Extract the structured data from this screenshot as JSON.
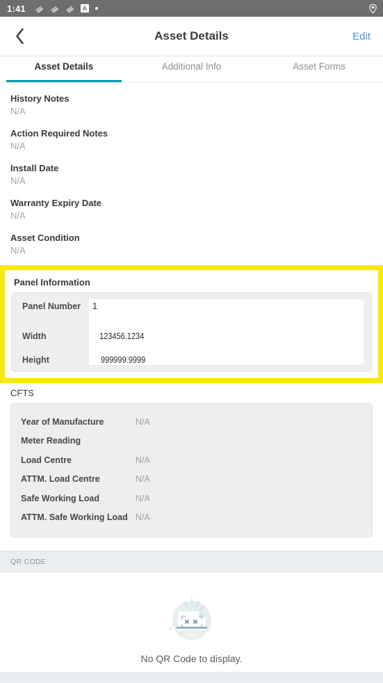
{
  "status_bar": {
    "time": "1:41",
    "left_icons": [
      "app-swirl-icon",
      "app-swirl-icon",
      "app-swirl-icon",
      "boxed-a-icon",
      "dot-icon"
    ],
    "boxed_a_label": "A",
    "right_icons": [
      "location-pin-icon"
    ],
    "background": "#6e6e6e"
  },
  "navbar": {
    "back_icon": "chevron-left-icon",
    "title": "Asset Details",
    "edit_label": "Edit",
    "edit_color": "#4a9ae0"
  },
  "tabs": {
    "active_index": 0,
    "accent": "#0198ad",
    "items": [
      {
        "label": "Asset Details"
      },
      {
        "label": "Additional Info"
      },
      {
        "label": "Asset Forms"
      }
    ]
  },
  "asset_details": {
    "fields": [
      {
        "label": "History Notes",
        "value": "N/A"
      },
      {
        "label": "Action Required Notes",
        "value": "N/A"
      },
      {
        "label": "Install Date",
        "value": "N/A"
      },
      {
        "label": "Warranty Expiry Date",
        "value": "N/A"
      },
      {
        "label": "Asset Condition",
        "value": "N/A"
      }
    ]
  },
  "panel_information": {
    "highlight_color": "#f9e800",
    "section_title": "Panel Information",
    "rows": [
      {
        "label": "Panel Number",
        "value": "1"
      },
      {
        "label": "Width",
        "value": "123456.1234"
      },
      {
        "label": "Height",
        "value": "999999.9999"
      }
    ]
  },
  "cfts": {
    "section_title": "CFTS",
    "rows": [
      {
        "label": "Year of Manufacture",
        "value": "N/A"
      },
      {
        "label": "Meter Reading",
        "value": ""
      },
      {
        "label": "Load Centre",
        "value": "N/A"
      },
      {
        "label": "ATTM. Load Centre",
        "value": "N/A"
      },
      {
        "label": "Safe Working Load",
        "value": "N/A"
      },
      {
        "label": "ATTM. Safe Working Load",
        "value": "N/A"
      }
    ]
  },
  "qr_code": {
    "header_label": "QR CODE",
    "empty_icon": "broken-qr-document-icon",
    "empty_text": "No QR Code to display.",
    "art_color": "#e3edee",
    "art_accent": "#7fa8ad"
  }
}
